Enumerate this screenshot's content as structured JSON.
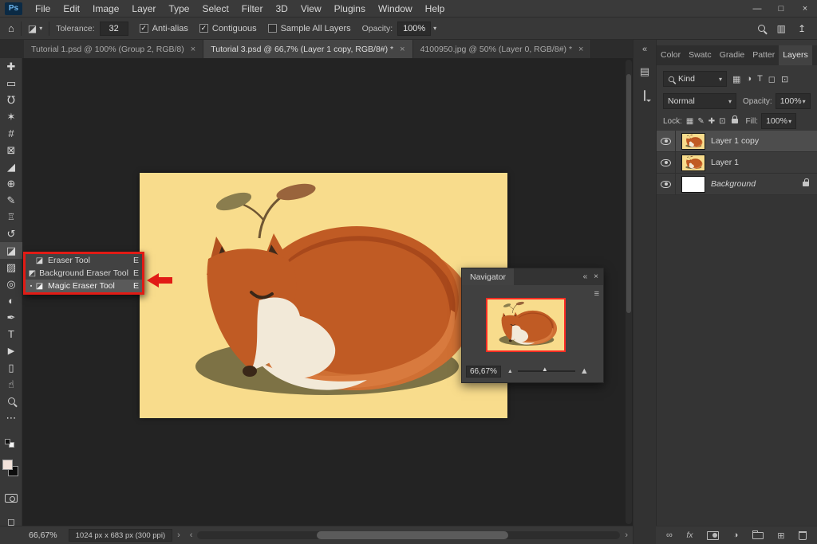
{
  "colors": {
    "accent_red": "#e11b15",
    "artboard_yellow": "#f8dc8c",
    "fox_orange": "#c05b24",
    "panel_gray": "#383838"
  },
  "icons": {
    "close": "×",
    "minimize": "—",
    "maximize": "□",
    "dropdown": "▾",
    "check": "✓",
    "home": "⌂",
    "collapse": "«",
    "menu": "≡",
    "left_arrow": "‹",
    "right_arrow": "›",
    "chevron": "›",
    "thumb_triangle": "▲",
    "link": "∞",
    "fx": "fx",
    "adjustment": "◑",
    "new_layer": "⊞",
    "delete": "⌫",
    "share": "↥",
    "workspace": "▥",
    "panel_list": "▤",
    "tool_preset": "◪",
    "current_tool_marker": "▪"
  },
  "menubar": {
    "app_icon": "Ps",
    "items": [
      "File",
      "Edit",
      "Image",
      "Layer",
      "Type",
      "Select",
      "Filter",
      "3D",
      "View",
      "Plugins",
      "Window",
      "Help"
    ]
  },
  "options_bar": {
    "tolerance_label": "Tolerance:",
    "tolerance_value": "32",
    "checkboxes": [
      {
        "label": "Anti-alias",
        "checked": true
      },
      {
        "label": "Contiguous",
        "checked": true
      },
      {
        "label": "Sample All Layers",
        "checked": false
      }
    ],
    "opacity_label": "Opacity:",
    "opacity_value": "100%"
  },
  "document_tabs": [
    {
      "title": "Tutorial 1.psd @ 100% (Group 2, RGB/8)",
      "active": false
    },
    {
      "title": "Tutorial 3.psd @ 66,7% (Layer 1 copy, RGB/8#) *",
      "active": true
    },
    {
      "title": "4100950.jpg @ 50% (Layer 0, RGB/8#) *",
      "active": false
    }
  ],
  "toolbar": {
    "tools": [
      {
        "name": "move-tool",
        "glyph": "✚"
      },
      {
        "name": "rectangular-marquee-tool",
        "glyph": "▭"
      },
      {
        "name": "lasso-tool",
        "glyph": "℧"
      },
      {
        "name": "quick-selection-tool",
        "glyph": "✶"
      },
      {
        "name": "crop-tool",
        "glyph": "#"
      },
      {
        "name": "frame-tool",
        "glyph": "⊠"
      },
      {
        "name": "eyedropper-tool",
        "glyph": "◢"
      },
      {
        "name": "spot-healing-brush-tool",
        "glyph": "⊕"
      },
      {
        "name": "brush-tool",
        "glyph": "✎"
      },
      {
        "name": "clone-stamp-tool",
        "glyph": "♖"
      },
      {
        "name": "history-brush-tool",
        "glyph": "↺"
      },
      {
        "name": "eraser-tool",
        "glyph": "◪",
        "selected": true
      },
      {
        "name": "gradient-tool",
        "glyph": "▨"
      },
      {
        "name": "blur-tool",
        "glyph": "◎"
      },
      {
        "name": "dodge-tool",
        "glyph": "◐"
      },
      {
        "name": "pen-tool",
        "glyph": "✒"
      },
      {
        "name": "horizontal-type-tool",
        "glyph": "T"
      },
      {
        "name": "path-selection-tool",
        "glyph": "▶"
      },
      {
        "name": "rectangle-tool",
        "glyph": "▯"
      },
      {
        "name": "hand-tool",
        "glyph": "☝"
      },
      {
        "name": "zoom-tool",
        "glyph": ""
      },
      {
        "name": "edit-toolbar",
        "glyph": "⋯"
      }
    ]
  },
  "tool_flyout": {
    "items": [
      {
        "label": "Eraser Tool",
        "shortcut": "E",
        "icon": "◪",
        "highlighted": false
      },
      {
        "label": "Background Eraser Tool",
        "shortcut": "E",
        "icon": "◩",
        "highlighted": false
      },
      {
        "label": "Magic Eraser Tool",
        "shortcut": "E",
        "icon": "◪",
        "highlighted": true
      }
    ]
  },
  "navigator": {
    "title": "Navigator",
    "zoom_value": "66,67%"
  },
  "panel_dock": {
    "tabs": [
      "Color",
      "Swatc",
      "Gradie",
      "Patter",
      "Layers"
    ],
    "active_tab": "Layers"
  },
  "layers_panel": {
    "filter_label": "Kind",
    "filter_icons": [
      "▦",
      "◑",
      "T",
      "◻",
      "⊡"
    ],
    "blend_mode": "Normal",
    "opacity_label": "Opacity:",
    "opacity_value": "100%",
    "lock_label": "Lock:",
    "lock_icons": [
      "▦",
      "✎",
      "✚",
      "⊡"
    ],
    "fill_label": "Fill:",
    "fill_value": "100%",
    "layers": [
      {
        "name": "Layer 1 copy",
        "selected": true,
        "thumb": "fox",
        "locked": false
      },
      {
        "name": "Layer 1",
        "selected": false,
        "thumb": "fox",
        "locked": false
      },
      {
        "name": "Background",
        "selected": false,
        "thumb": "white",
        "locked": true
      }
    ]
  },
  "status_bar": {
    "zoom": "66,67%",
    "doc_info": "1024 px x 683 px (300 ppi)"
  }
}
